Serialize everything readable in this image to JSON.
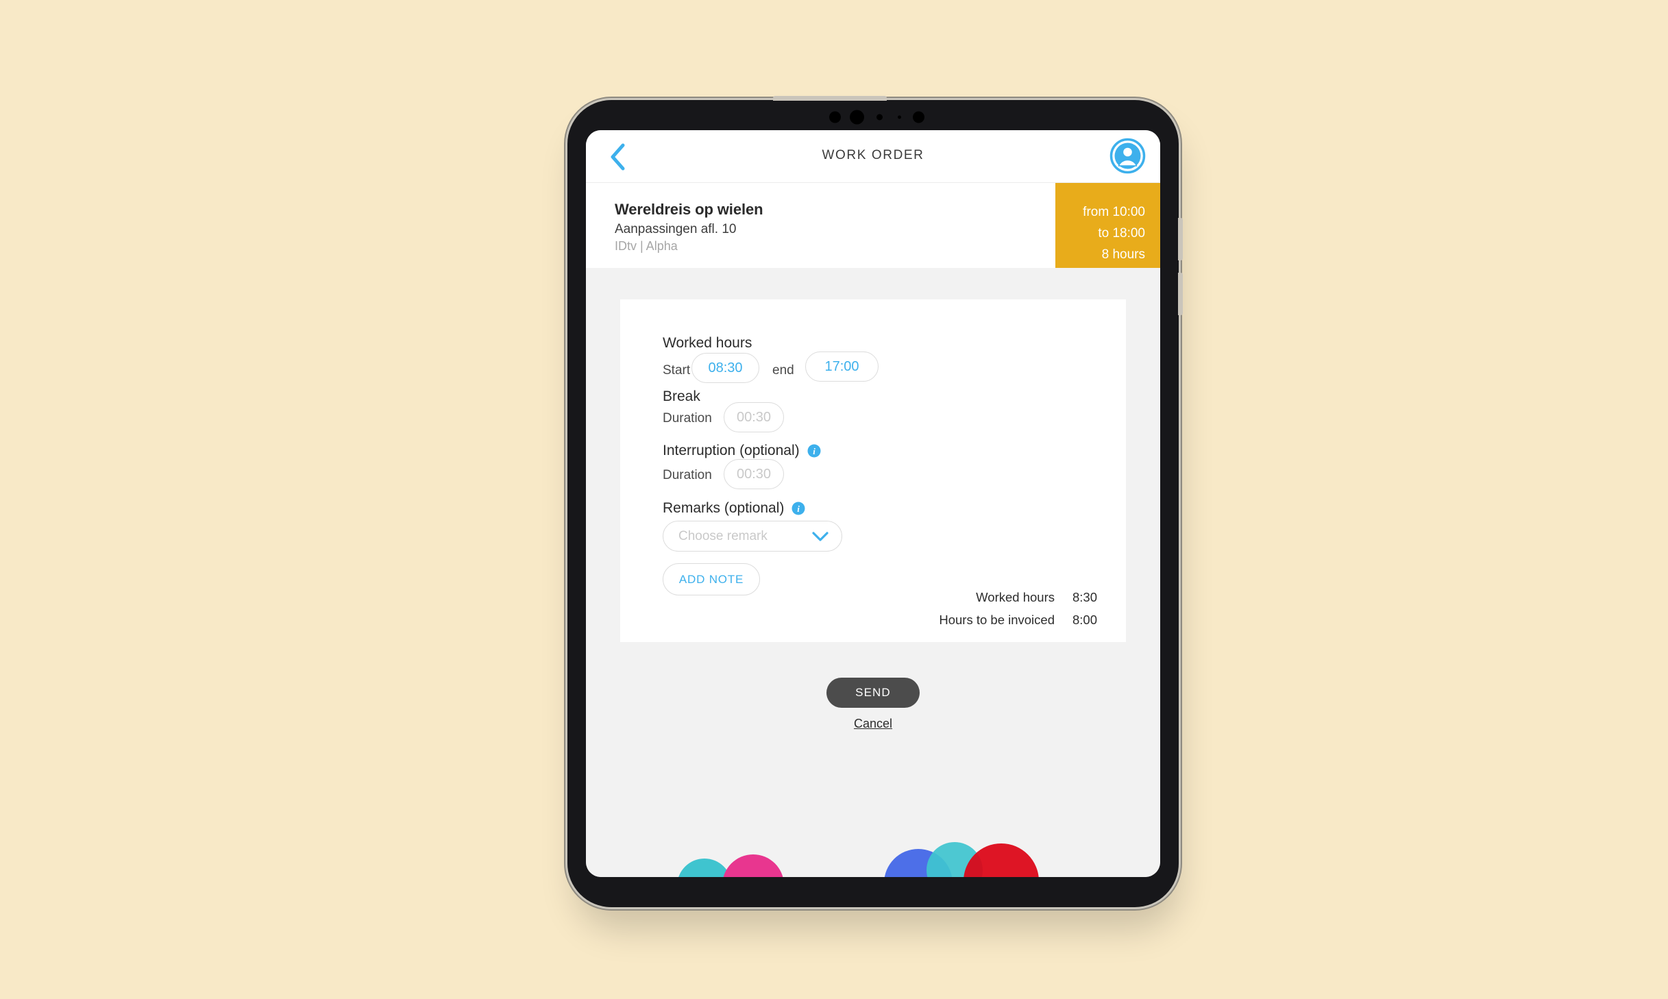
{
  "app": {
    "title": "WORK ORDER",
    "back_icon": "chevron-left-icon",
    "avatar_icon": "user-avatar-icon"
  },
  "job": {
    "title": "Wereldreis op wielen",
    "subtitle": "Aanpassingen afl. 10",
    "meta": "IDtv | Alpha",
    "badge": {
      "from": "from 10:00",
      "to": "to 18:00",
      "total": "8 hours",
      "color": "#e8ac1b"
    }
  },
  "form": {
    "worked_hours": {
      "title": "Worked hours",
      "start_label": "Start",
      "start_value": "08:30",
      "end_label": "end",
      "end_value": "17:00"
    },
    "break": {
      "title": "Break",
      "duration_label": "Duration",
      "duration_placeholder": "00:30"
    },
    "interruption": {
      "title": "Interruption (optional)",
      "info_icon": "info-icon",
      "duration_label": "Duration",
      "duration_placeholder": "00:30"
    },
    "remarks": {
      "title": "Remarks (optional)",
      "info_icon": "info-icon",
      "select_placeholder": "Choose remark",
      "chevron_icon": "chevron-down-icon"
    },
    "add_note_label": "ADD NOTE"
  },
  "summary": {
    "rows": [
      {
        "label": "Worked hours",
        "value": "8:30"
      },
      {
        "label": "Hours to be invoiced",
        "value": "8:00"
      }
    ]
  },
  "footer": {
    "send_label": "SEND",
    "cancel_label": "Cancel"
  },
  "theme": {
    "accent": "#3db0ec",
    "amber": "#e8ac1b",
    "send_button": "#4c4c4c",
    "page_background": "#f8e9c7",
    "screen_background": "#f2f2f2"
  }
}
